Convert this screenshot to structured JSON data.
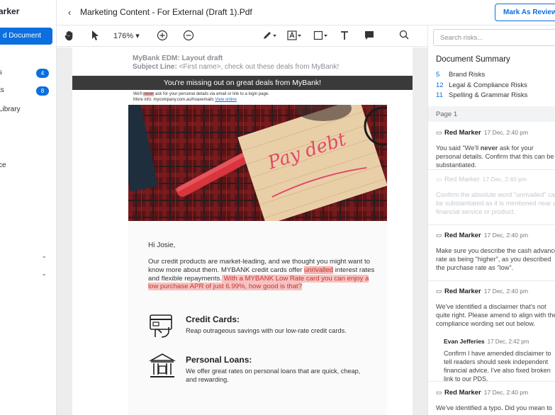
{
  "app": {
    "brand": "arker",
    "nav_primary": "d Document",
    "side_items": [
      {
        "label": "s",
        "badge": "4"
      },
      {
        "label": "ts",
        "badge": "8"
      },
      {
        "label": "Library"
      },
      {
        "label": "ce"
      }
    ]
  },
  "topbar": {
    "title": "Marketing Content - For External (Draft 1).Pdf",
    "review_button": "Mark As Reviewed"
  },
  "toolbar": {
    "zoom": "176%"
  },
  "document": {
    "header_line1": "MyBank EDM: Layout draft",
    "subject_label": "Subject Line:",
    "subject_text": " <First name>, check out these deals from MyBank!",
    "banner": "You're missing out on great deals from MyBank!",
    "note_line1_pre": "We'll ",
    "note_line1_hl": "never",
    "note_line1_post": " ask for your personal details via email or link to a login page.",
    "note_line2_pre": "More info: mycompany.com.au/hoaxemails ",
    "note_line2_link": "View online",
    "hero_text": "Pay debt",
    "greeting": "Hi Josie,",
    "para_1": "Our credit products are market-leading, and we thought you might want to know more about them. MYBANK credit cards offer ",
    "para_hl1": "unrivalled",
    "para_2": " interest rates and flexible repayments.",
    "para_hl2": " With a MYBANK Low Rate card you can enjoy a low purchase APR of just 6.99%, how good is that?",
    "features": [
      {
        "title": "Credit Cards:",
        "desc": "Reap outrageous savings with our low-rate credit cards."
      },
      {
        "title": "Personal Loans:",
        "desc": "We offer great rates on personal loans that are quick, cheap, and rewarding."
      }
    ]
  },
  "panel": {
    "search_placeholder": "Search risks...",
    "summary_title": "Document Summary",
    "summary": [
      {
        "count": "5",
        "label": "Brand Risks"
      },
      {
        "count": "12",
        "label": "Legal & Compliance Risks"
      },
      {
        "count": "11",
        "label": "Spelling & Grammar Risks"
      }
    ],
    "page_label": "Page 1",
    "comments": [
      {
        "author": "Red Marker",
        "date": "17 Dec, 2:40 pm",
        "text_pre": "You said \"We'll ",
        "text_bold": "never",
        "text_post": " ask for your personal details. Confirm that this can be substantiated."
      },
      {
        "author": "Red Marker",
        "date": "17 Dec, 2:40 pm",
        "text": "Confirm the absolute word \"unrivalled\" can be substantiated as it is mentioned near a financial service or product."
      },
      {
        "author": "Red Marker",
        "date": "17 Dec, 2:40 pm",
        "text": "Make sure you describe the cash advance rate as being \"higher\", as you described the purchase rate as \"low\"."
      },
      {
        "author": "Red Marker",
        "date": "17 Dec, 2:40 pm",
        "text": "We've identified a disclaimer that's not quite right. Please amend to align with the compliance wording set out below."
      },
      {
        "author": "Red Marker",
        "date": "17 Dec, 2:40 pm",
        "text": "We've identified a typo. Did you mean to say..."
      }
    ],
    "reply": {
      "author": "Evan Jefferies",
      "date": "17 Dec, 2:42 pm",
      "text": "Confirm I have amended disclaimer to tell readers should seek independent financial advice. I've also fixed broken link to our PDS."
    }
  }
}
